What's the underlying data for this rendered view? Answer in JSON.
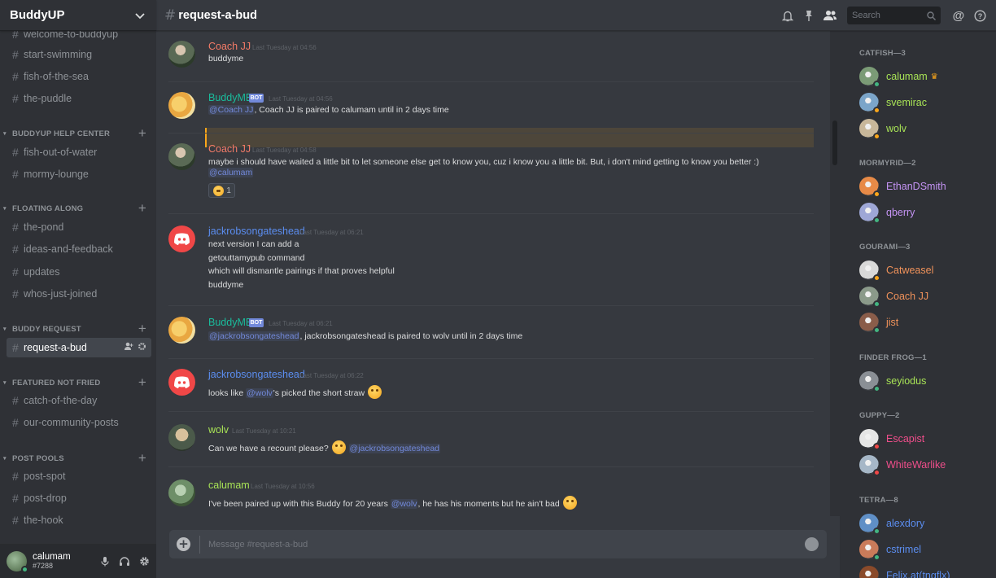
{
  "server": {
    "name": "BuddyUP"
  },
  "sidebar": {
    "items": [
      {
        "type": "channel",
        "label": "welcome-to-buddyup",
        "glyph": "#"
      },
      {
        "type": "channel",
        "label": "start-swimming",
        "glyph": "#"
      },
      {
        "type": "channel",
        "label": "fish-of-the-sea",
        "glyph": "#"
      },
      {
        "type": "channel",
        "label": "the-puddle",
        "glyph": "#"
      },
      {
        "type": "category",
        "label": "BUDDYUP HELP CENTER"
      },
      {
        "type": "channel",
        "label": "fish-out-of-water",
        "glyph": "#"
      },
      {
        "type": "channel",
        "label": "mormy-lounge",
        "glyph": "#"
      },
      {
        "type": "category",
        "label": "FLOATING ALONG"
      },
      {
        "type": "channel",
        "label": "the-pond",
        "glyph": "#"
      },
      {
        "type": "channel",
        "label": "ideas-and-feedback",
        "glyph": "#"
      },
      {
        "type": "channel",
        "label": "updates",
        "glyph": "#"
      },
      {
        "type": "channel",
        "label": "whos-just-joined",
        "glyph": "#"
      },
      {
        "type": "category",
        "label": "BUDDY REQUEST"
      },
      {
        "type": "channel",
        "label": "request-a-bud",
        "glyph": "#",
        "active": true
      },
      {
        "type": "category",
        "label": "FEATURED NOT FRIED"
      },
      {
        "type": "channel",
        "label": "catch-of-the-day",
        "glyph": "#"
      },
      {
        "type": "channel",
        "label": "our-community-posts",
        "glyph": "#"
      },
      {
        "type": "category",
        "label": "POST POOLS"
      },
      {
        "type": "channel",
        "label": "post-spot",
        "glyph": "#"
      },
      {
        "type": "channel",
        "label": "post-drop",
        "glyph": "#"
      },
      {
        "type": "channel",
        "label": "the-hook",
        "glyph": "#"
      }
    ]
  },
  "user_panel": {
    "name": "calumam",
    "tag": "#7288"
  },
  "header": {
    "hash": "#",
    "channel": "request-a-bud",
    "search_placeholder": "Search"
  },
  "messages": [
    {
      "author": "Coach JJ",
      "author_color": "#f47b67",
      "timestamp": "Last Tuesday at 04:56",
      "bot": false,
      "avatar": "coach",
      "lines": [
        {
          "text": "buddyme"
        }
      ]
    },
    {
      "author": "BuddyME",
      "author_color": "#1abc9c",
      "timestamp": "Last Tuesday at 04:56",
      "bot": true,
      "bot_label": "BOT",
      "avatar": "buddyme",
      "lines": [
        {
          "mention": "@Coach JJ",
          "text": ", Coach JJ is paired to calumam until in 2 days time"
        }
      ]
    },
    {
      "author": "Coach JJ",
      "author_color": "#f47b67",
      "timestamp": "Last Tuesday at 04:58",
      "bot": false,
      "avatar": "coach",
      "lines": [
        {
          "text": "maybe i should have waited a little bit to let someone else get to know you, cuz i know you a little bit. But, i don't mind getting to know you better :)"
        },
        {
          "mention": "@calumam",
          "text": ""
        }
      ],
      "reaction": {
        "count": "1"
      }
    },
    {
      "author": "jackrobsongateshead",
      "author_color": "#5b8def",
      "timestamp": "Last Tuesday at 06:21",
      "bot": false,
      "avatar": "discord",
      "lines": [
        {
          "text": "next version I can add a"
        },
        {
          "text": "getouttamypub command"
        },
        {
          "text": "which will dismantle pairings if that proves helpful"
        },
        {
          "text": "buddyme"
        }
      ]
    },
    {
      "author": "BuddyME",
      "author_color": "#1abc9c",
      "timestamp": "Last Tuesday at 06:21",
      "bot": true,
      "bot_label": "BOT",
      "avatar": "buddyme",
      "lines": [
        {
          "mention": "@jackrobsongateshead",
          "text": ", jackrobsongateshead is paired to wolv until in 2 days time"
        }
      ]
    },
    {
      "author": "jackrobsongateshead",
      "author_color": "#5b8def",
      "timestamp": "Last Tuesday at 06:22",
      "bot": false,
      "avatar": "discord",
      "lines": [
        {
          "prefix": "looks like ",
          "mention": "@wolv",
          "text": "'s picked the short straw",
          "emoji": true
        }
      ]
    },
    {
      "author": "wolv",
      "author_color": "#a8e356",
      "timestamp": "Last Tuesday at 10:21",
      "bot": false,
      "avatar": "wolv",
      "lines": [
        {
          "prefix": "Can we have a recount please? ",
          "emoji_mid": true,
          "mention": "@jackrobsongateshead",
          "text": ""
        }
      ]
    },
    {
      "author": "calumam",
      "author_color": "#a8e356",
      "timestamp": "Last Tuesday at 10:56",
      "bot": false,
      "avatar": "calumam",
      "lines": [
        {
          "prefix": "I've been paired up with this Buddy for 20 years ",
          "mention": "@wolv",
          "text": ", he has his moments but he ain't bad",
          "emoji": true
        }
      ]
    }
  ],
  "composer": {
    "placeholder": "Message #request-a-bud"
  },
  "members": {
    "groups": [
      {
        "role": "CATFISH—3",
        "members": [
          {
            "name": "calumam",
            "color": "#a8e356",
            "status": "#43b581",
            "crown": true,
            "avatar": "#7b9b76"
          },
          {
            "name": "svemirac",
            "color": "#a8e356",
            "status": "#faa61a",
            "avatar": "#7ba5c9"
          },
          {
            "name": "wolv",
            "color": "#a8e356",
            "status": "#faa61a",
            "avatar": "#c8b79a"
          }
        ]
      },
      {
        "role": "MORMYRID—2",
        "members": [
          {
            "name": "EthanDSmith",
            "color": "#c594f5",
            "status": "#faa61a",
            "avatar": "#e78a47"
          },
          {
            "name": "qberry",
            "color": "#c594f5",
            "status": "#43b581",
            "avatar": "#9ea7d6"
          }
        ]
      },
      {
        "role": "GOURAMI—3",
        "members": [
          {
            "name": "Catweasel",
            "color": "#f0925a",
            "status": "#faa61a",
            "avatar": "#d9d9d9"
          },
          {
            "name": "Coach JJ",
            "color": "#f0925a",
            "status": "#43b581",
            "avatar": "#8b9a8a"
          },
          {
            "name": "jist",
            "color": "#f0925a",
            "status": "#43b581",
            "avatar": "#8a5d4a"
          }
        ]
      },
      {
        "role": "FINDER FROG—1",
        "members": [
          {
            "name": "seyiodus",
            "color": "#a8e356",
            "status": "#43b581",
            "avatar": "#8a8f95"
          }
        ]
      },
      {
        "role": "GUPPY—2",
        "members": [
          {
            "name": "Escapist",
            "color": "#f04e8b",
            "status": "#f04747",
            "avatar": "#e6e6e6"
          },
          {
            "name": "WhiteWarlike",
            "color": "#f04e8b",
            "status": "#f04747",
            "avatar": "#a6b7c7"
          }
        ]
      },
      {
        "role": "TETRA—8",
        "members": [
          {
            "name": "alexdory",
            "color": "#5b8def",
            "status": "#43b581",
            "avatar": "#5f8fc6"
          },
          {
            "name": "cstrimel",
            "color": "#5b8def",
            "status": "#43b581",
            "avatar": "#c97b5a"
          },
          {
            "name": "Felix.at(tngflx)",
            "color": "#5b8def",
            "status": "#43b581",
            "avatar": "#8a4a2a"
          }
        ]
      }
    ]
  }
}
